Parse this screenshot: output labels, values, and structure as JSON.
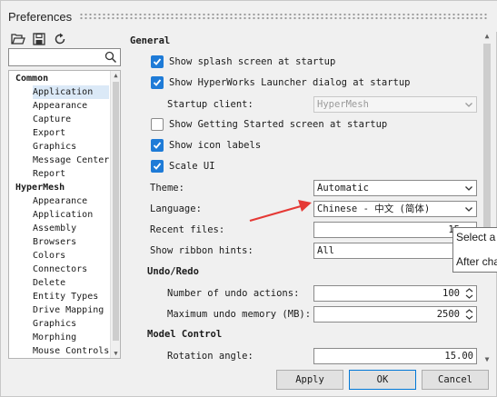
{
  "window": {
    "title": "Preferences"
  },
  "toolbar": {
    "icons": [
      "open-folder-icon",
      "save-icon",
      "reset-icon"
    ]
  },
  "search": {
    "value": "",
    "placeholder": ""
  },
  "tree": {
    "common_label": "Common",
    "common_items": [
      "Application",
      "Appearance",
      "Capture",
      "Export",
      "Graphics",
      "Message Center",
      "Report"
    ],
    "hypermesh_label": "HyperMesh",
    "hypermesh_items": [
      "Appearance",
      "Application",
      "Assembly",
      "Browsers",
      "Colors",
      "Connectors",
      "Delete",
      "Entity Types",
      "Drive Mapping",
      "Graphics",
      "Morphing",
      "Mouse Controls"
    ],
    "selected": "Application"
  },
  "general": {
    "heading": "General",
    "splash": {
      "label": "Show splash screen at startup",
      "checked": true
    },
    "launcher": {
      "label": "Show HyperWorks Launcher dialog at startup",
      "checked": true
    },
    "startup_client": {
      "label": "Startup client:",
      "value": "HyperMesh"
    },
    "getting_started": {
      "label": "Show Getting Started screen at startup",
      "checked": false
    },
    "icon_labels": {
      "label": "Show icon labels",
      "checked": true
    },
    "scale_ui": {
      "label": "Scale UI",
      "checked": true
    },
    "theme": {
      "label": "Theme:",
      "value": "Automatic"
    },
    "language": {
      "label": "Language:",
      "value": "Chinese - 中文 (简体)"
    },
    "recent_files": {
      "label": "Recent files:",
      "value": "15"
    },
    "ribbon_hints": {
      "label": "Show ribbon hints:",
      "value": "All"
    }
  },
  "undo": {
    "heading": "Undo/Redo",
    "actions": {
      "label": "Number of undo actions:",
      "value": "100"
    },
    "memory": {
      "label": "Maximum undo memory (MB):",
      "value": "2500"
    }
  },
  "model": {
    "heading": "Model Control",
    "rotation": {
      "label": "Rotation angle:",
      "value": "15.00"
    }
  },
  "buttons": {
    "apply": "Apply",
    "ok": "OK",
    "cancel": "Cancel"
  },
  "tooltip": {
    "line1": "Select a l",
    "line2": "After cha"
  },
  "colors": {
    "accent": "#1e7bd7",
    "arrow": "#e53935",
    "selection": "#dbe9f7"
  }
}
